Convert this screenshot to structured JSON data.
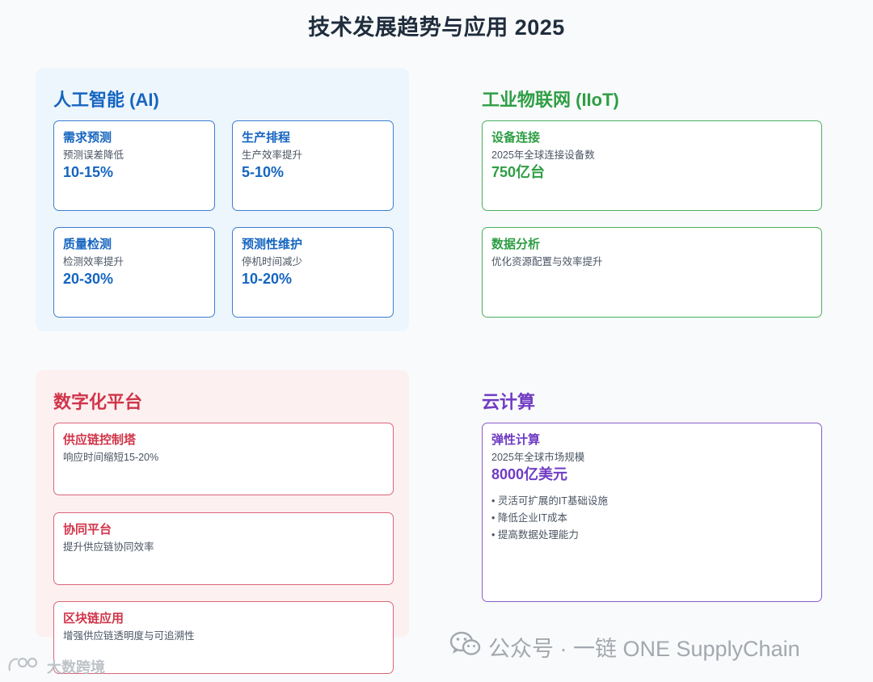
{
  "header": {
    "title": "技术发展趋势与应用 2025"
  },
  "sections": {
    "ai": {
      "title": "人工智能 (AI)",
      "cards": [
        {
          "title": "需求预测",
          "desc": "预测误差降低",
          "value": "10-15%"
        },
        {
          "title": "生产排程",
          "desc": "生产效率提升",
          "value": "5-10%"
        },
        {
          "title": "质量检测",
          "desc": "检测效率提升",
          "value": "20-30%"
        },
        {
          "title": "预测性维护",
          "desc": "停机时间减少",
          "value": "10-20%"
        }
      ]
    },
    "iiot": {
      "title": "工业物联网 (IIoT)",
      "cards": [
        {
          "title": "设备连接",
          "desc": "2025年全球连接设备数",
          "value": "750亿台"
        },
        {
          "title": "数据分析",
          "desc": "优化资源配置与效率提升"
        }
      ]
    },
    "digital": {
      "title": "数字化平台",
      "cards": [
        {
          "title": "供应链控制塔",
          "desc": "响应时间缩短15-20%"
        },
        {
          "title": "协同平台",
          "desc": "提升供应链协同效率"
        },
        {
          "title": "区块链应用",
          "desc": "增强供应链透明度与可追溯性"
        }
      ]
    },
    "cloud": {
      "title": "云计算",
      "cards": [
        {
          "title": "弹性计算",
          "desc": "2025年全球市场规模",
          "value": "8000亿美元",
          "bullets": [
            "灵活可扩展的IT基础设施",
            "降低企业IT成本",
            "提高数据处理能力"
          ]
        }
      ]
    }
  },
  "watermarks": {
    "right": "公众号 · 一链 ONE SupplyChain",
    "left": "大数跨境"
  },
  "colors": {
    "ai": "#1565c0",
    "iiot": "#2e9e44",
    "digital": "#d0354a",
    "cloud": "#6f3cc3"
  }
}
